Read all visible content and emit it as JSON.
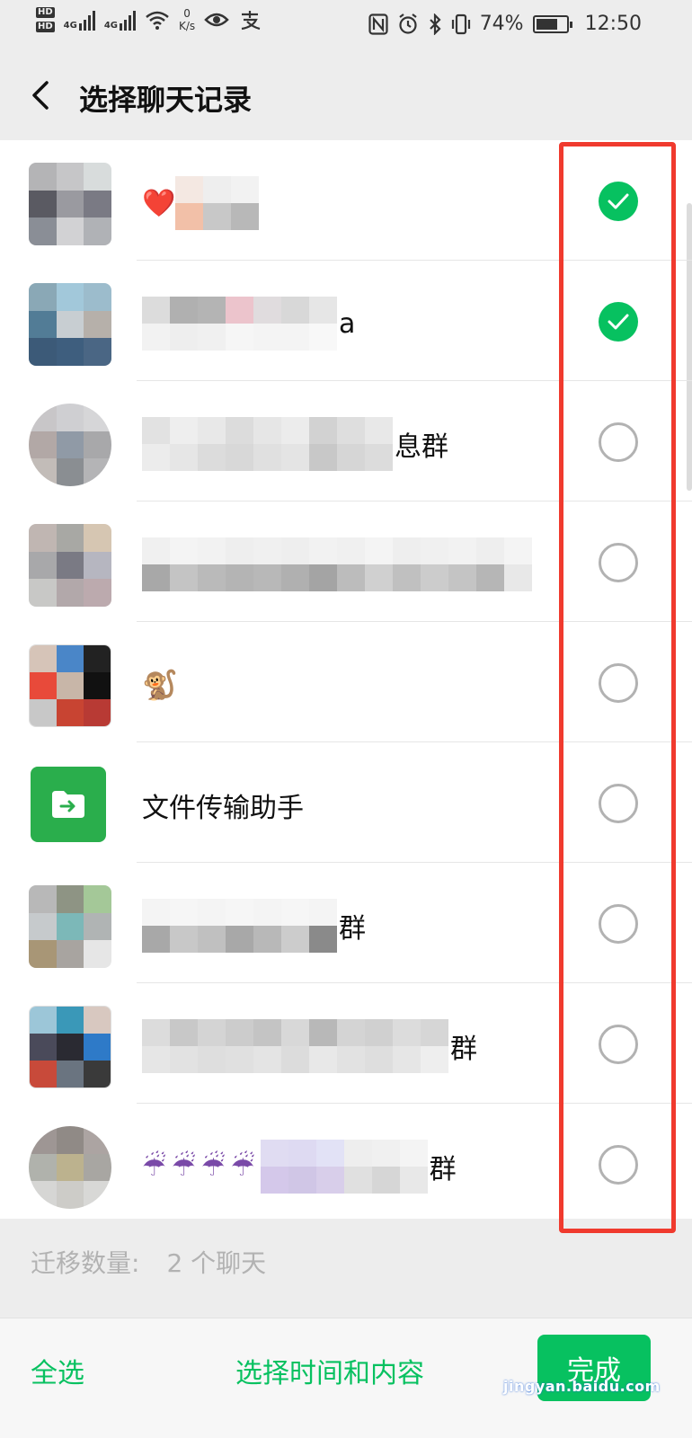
{
  "status_bar": {
    "hd1": "HD",
    "hd2": "HD",
    "net1": "4G",
    "net2": "4G",
    "speed_value": "0",
    "speed_unit": "K/s",
    "battery": "74%",
    "battery_level": 0.74,
    "time": "12:50"
  },
  "header": {
    "title": "选择聊天记录"
  },
  "chats": [
    {
      "suffix": "",
      "emoji": "❤️",
      "checked": true
    },
    {
      "suffix": "a",
      "emoji": "",
      "checked": true
    },
    {
      "suffix": "息群",
      "emoji": "",
      "checked": false
    },
    {
      "suffix": "",
      "emoji": "",
      "checked": false
    },
    {
      "suffix": "",
      "emoji": "🐒",
      "checked": false
    },
    {
      "suffix": "",
      "name": "文件传输助手",
      "checked": false
    },
    {
      "suffix": "群",
      "emoji": "",
      "checked": false
    },
    {
      "suffix": "群",
      "emoji": "",
      "checked": false
    },
    {
      "suffix": "群",
      "emoji": "☔☔☔☔",
      "checked": false
    }
  ],
  "summary": {
    "label": "迁移数量:",
    "value": "2 个聊天"
  },
  "bottom_bar": {
    "select_all": "全选",
    "select_time": "选择时间和内容",
    "done": "完成"
  },
  "watermark": {
    "text": "jingyan.baidu.com"
  },
  "colors": {
    "accent": "#07c160",
    "highlight": "#f03a2e",
    "background": "#ededed"
  }
}
